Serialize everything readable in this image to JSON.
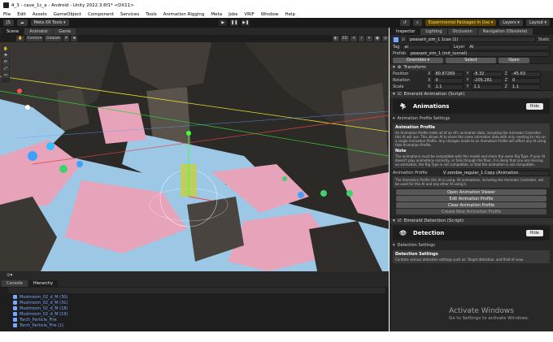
{
  "window": {
    "title": "4_3 - cave_1c_a - Android - Unity 2022.3.6f1* <DX11>"
  },
  "menu": [
    "File",
    "Edit",
    "Assets",
    "GameObject",
    "Component",
    "Services",
    "Tools",
    "Animation Rigging",
    "Meta",
    "Jobs",
    "VRIF",
    "Window",
    "Help"
  ],
  "toolbar": {
    "account": "JS",
    "meta_xr": "Meta XR Tools",
    "experimental": "Experimental Packages In Use",
    "layers": "Layers",
    "layout": "Layout"
  },
  "scene_tabs": [
    "Scene",
    "Animator",
    "Game"
  ],
  "scene_toolbar": {
    "pivot": "Center",
    "space": "Global"
  },
  "bottom_tabs": [
    "Console",
    "Hierarchy"
  ],
  "hierarchy": [
    "Mushroom_02_d_M (30)",
    "Mushroom_02_d_M (31)",
    "Mushroom_02_d_M (18)",
    "Mushroom_02_d_M (19)",
    "Torch_Particle_Fire",
    "Torch_Particle_Fire (1)"
  ],
  "inspector": {
    "tabs": [
      "Inspector",
      "Lighting",
      "Occlusion",
      "Navigation (Obsolete)"
    ],
    "object_name": "peasant_zim_1 1cav (1)",
    "static_label": "Static",
    "tag_label": "Tag",
    "tag_value": "ai",
    "layer_label": "Layer",
    "layer_value": "AI",
    "prefab_label": "Prefab",
    "prefab_value": "peasant_zim_1 (mit_tunnel)",
    "overrides": "Overrides",
    "select": "Select",
    "open": "Open",
    "transform": {
      "title": "Transform",
      "position_label": "Position",
      "rotation_label": "Rotation",
      "scale_label": "Scale",
      "position": {
        "x": "80.87289",
        "y": "-8.32",
        "z": "-45.63"
      },
      "rotation": {
        "x": "0",
        "y": "-205.281",
        "z": "0"
      },
      "scale": {
        "x": "1.1",
        "y": "1.1",
        "z": "1.1"
      }
    },
    "emerald_animation": {
      "title": "Emerald Animation (Script)",
      "header": "Animations",
      "hide": "Hide",
      "settings": "Animation Profile Settings",
      "profile_box_title": "Animation Profile",
      "profile_box_text": "An Animation Profile holds all of an AI's animation data, including the Animator Controller this AI will use. This allows AI to share the same animation data with only needing to rely on a single Animation Profile. Any changes made to an Animation Profile will affect any AI using that Animation Profile.",
      "note_title": "Note",
      "note_text": "The animations must be compatible with this model and share the same Rig Type. If your AI doesn't play animations correctly, or falls through the floor, it is likely that you are missing an animation, the Rig Type is not compatible, or that the animation is not compatible.",
      "profile_label": "Animation Profile",
      "profile_value": "V zombie_regular_1 Copy (Animation",
      "profile_desc": "The Animation Profile this AI is using. All animations, including the Animator Controller, will be used for this AI and any other AI using it.",
      "buttons": [
        "Open Animation Viewer",
        "Edit Animation Profile",
        "Clear Animation Profile",
        "Create New Animation Profile"
      ]
    },
    "emerald_detection": {
      "title": "Emerald Detection (Script)",
      "header": "Detection",
      "hide": "Hide",
      "settings": "Detection Settings",
      "box_title": "Detection Settings",
      "box_text": "Controls various detection settings such as: Target detection, and field of view."
    }
  },
  "watermark": {
    "line1": "Activate Windows",
    "line2": "Go to Settings to activate Windows."
  },
  "colors": {
    "accent": "#ffd56b",
    "background": "#282828",
    "hierarchy_text": "#7aa7ff"
  }
}
